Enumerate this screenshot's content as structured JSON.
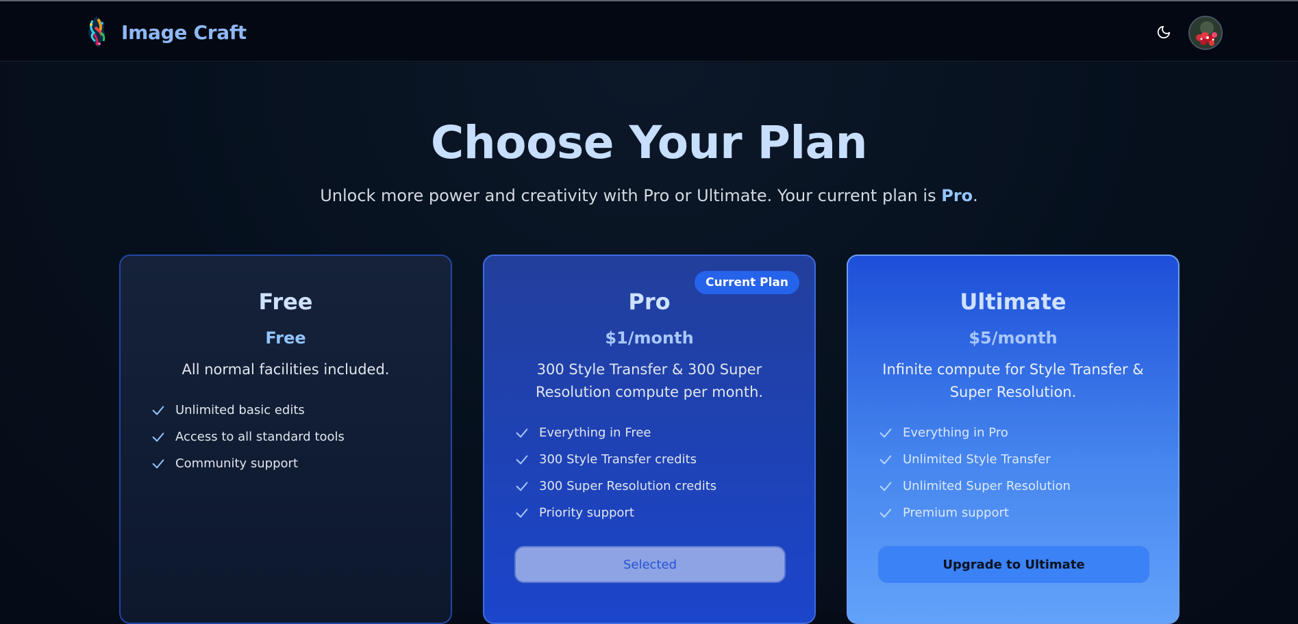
{
  "header": {
    "brand_name": "Image Craft",
    "theme_toggle_icon": "moon-icon",
    "logo_icon": "paint-splash-logo",
    "avatar": "user-avatar"
  },
  "hero": {
    "title": "Choose Your Plan",
    "subtitle_prefix": "Unlock more power and creativity with Pro or Ultimate. Your current plan is ",
    "current_plan": "Pro",
    "subtitle_suffix": "."
  },
  "plans": [
    {
      "name": "Free",
      "price": "Free",
      "description": "All normal facilities included.",
      "features": [
        "Unlimited basic edits",
        "Access to all standard tools",
        "Community support"
      ]
    },
    {
      "name": "Pro",
      "price": "$1/month",
      "badge": "Current Plan",
      "description": "300 Style Transfer & 300 Super Resolution compute per month.",
      "features": [
        "Everything in Free",
        "300 Style Transfer credits",
        "300 Super Resolution credits",
        "Priority support"
      ],
      "button_label": "Selected"
    },
    {
      "name": "Ultimate",
      "price": "$5/month",
      "description": "Infinite compute for Style Transfer & Super Resolution.",
      "features": [
        "Everything in Pro",
        "Unlimited Style Transfer",
        "Unlimited Super Resolution",
        "Premium support"
      ],
      "button_label": "Upgrade to Ultimate"
    }
  ],
  "colors": {
    "background": "#050c17",
    "accent": "#93c5fd",
    "badge": "#2563eb",
    "upgrade_button": "#3b82f6",
    "selected_button": "#8ea3e4"
  }
}
